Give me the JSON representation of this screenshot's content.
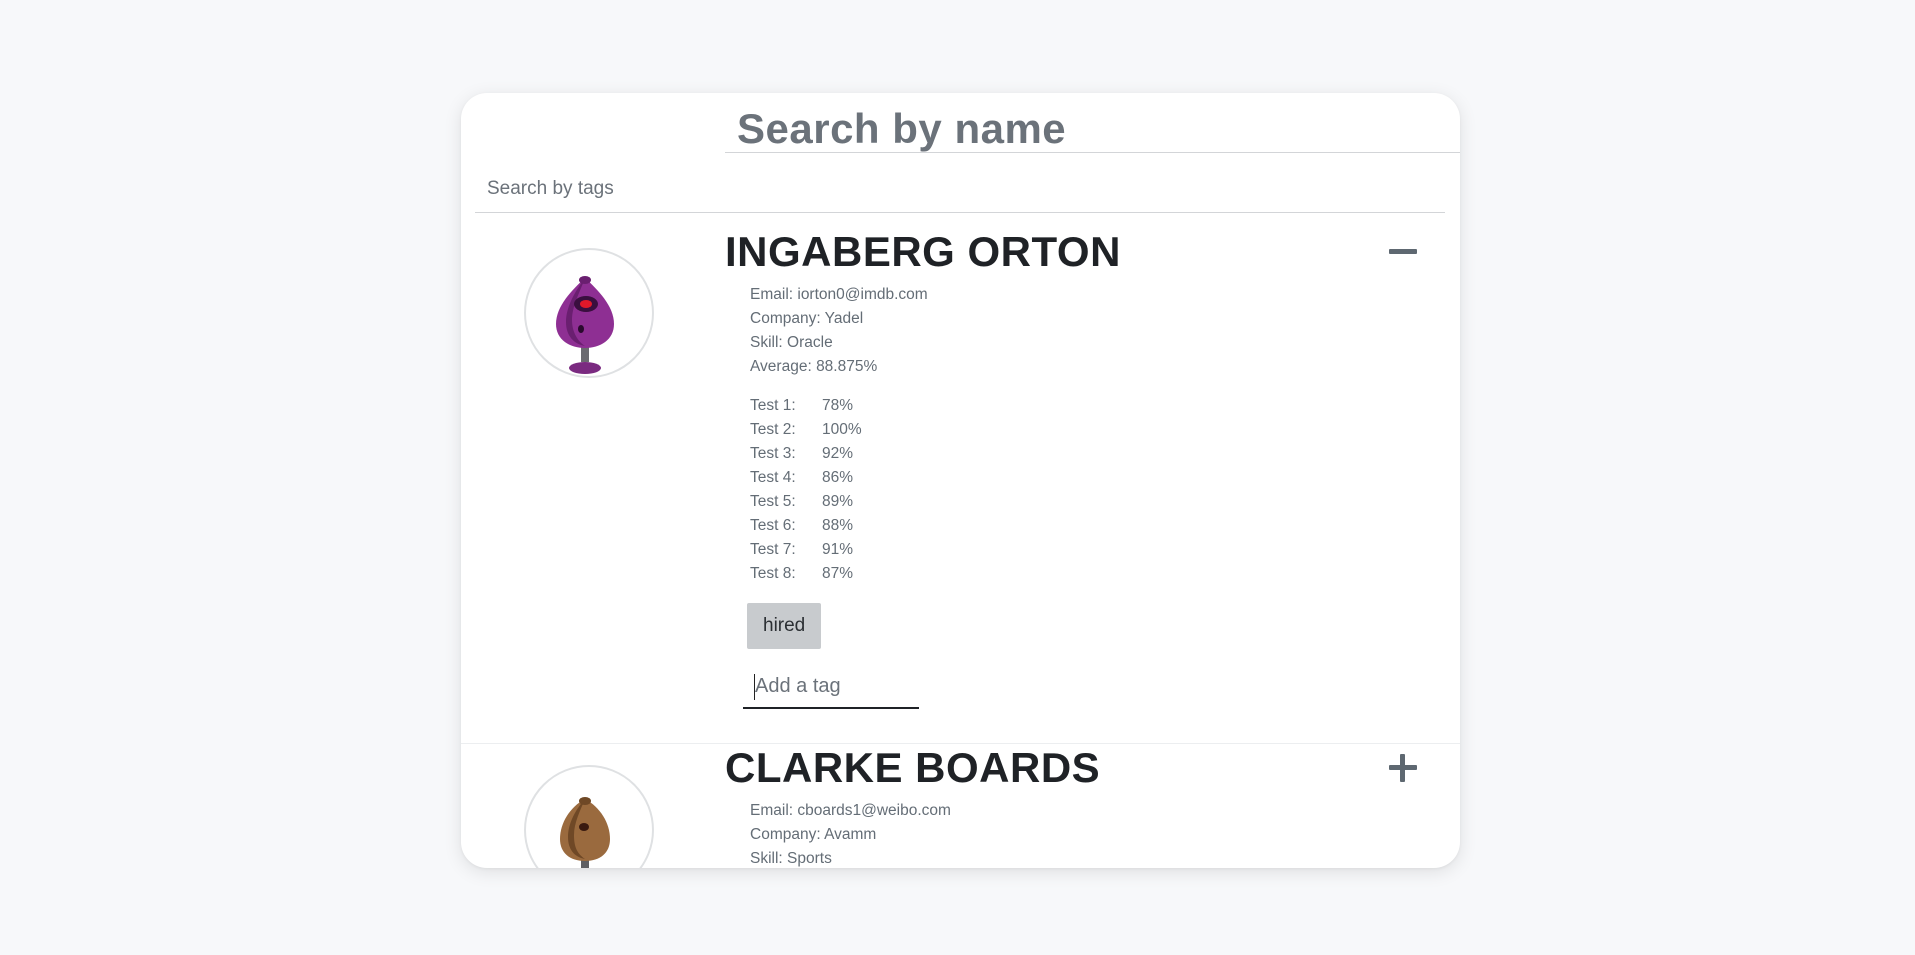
{
  "search": {
    "name_placeholder": "Search by name",
    "tags_placeholder": "Search by tags"
  },
  "students": [
    {
      "name": "INGABERG ORTON",
      "expanded": true,
      "toggle_icon": "minus-icon",
      "email": "Email: iorton0@imdb.com",
      "company": "Company: Yadel",
      "skill": "Skill: Oracle",
      "average": "Average: 88.875%",
      "grades": [
        {
          "label": "Test 1:",
          "value": "78%"
        },
        {
          "label": "Test 2:",
          "value": "100%"
        },
        {
          "label": "Test 3:",
          "value": "92%"
        },
        {
          "label": "Test 4:",
          "value": "86%"
        },
        {
          "label": "Test 5:",
          "value": "89%"
        },
        {
          "label": "Test 6:",
          "value": "88%"
        },
        {
          "label": "Test 7:",
          "value": "91%"
        },
        {
          "label": "Test 8:",
          "value": "87%"
        }
      ],
      "tags": [
        "hired"
      ],
      "tag_input_placeholder": "Add a tag",
      "avatar_color": "#8e2f93"
    },
    {
      "name": "CLARKE BOARDS",
      "expanded": false,
      "toggle_icon": "plus-icon",
      "email": "Email: cboards1@weibo.com",
      "company": "Company: Avamm",
      "skill": "Skill: Sports",
      "avatar_color": "#9a6a3e"
    }
  ]
}
